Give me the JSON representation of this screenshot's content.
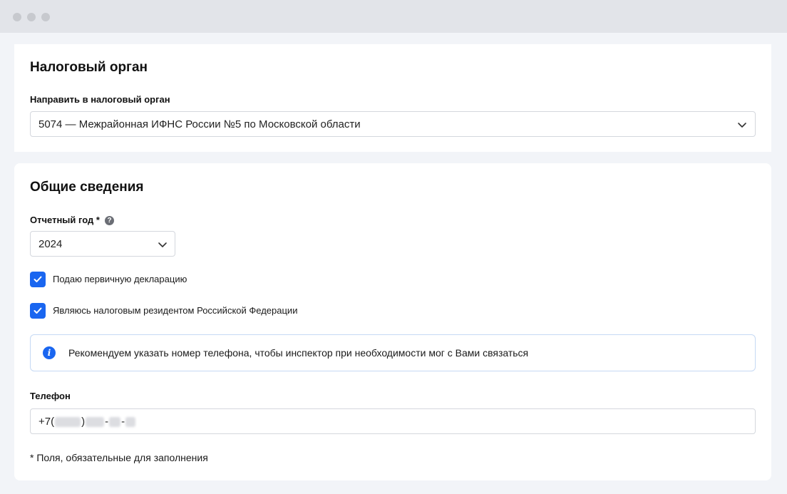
{
  "tax_authority": {
    "title": "Налоговый орган",
    "field_label": "Направить в налоговый орган",
    "selected": "5074 — Межрайонная ИФНС России №5 по Московской области"
  },
  "general": {
    "title": "Общие сведения",
    "year_label": "Отчетный год *",
    "year_value": "2024",
    "help_glyph": "?",
    "checkboxes": [
      {
        "label": "Подаю первичную декларацию",
        "checked": true
      },
      {
        "label": "Являюсь налоговым резидентом Российской Федерации",
        "checked": true
      }
    ],
    "info_glyph": "i",
    "info_text": "Рекомендуем указать номер телефона, чтобы инспектор при необходимости мог с Вами связаться",
    "phone_label": "Телефон",
    "phone_parts": [
      "+7(",
      ")",
      "-",
      "-"
    ],
    "footnote": "* Поля, обязательные для заполнения"
  },
  "colors": {
    "accent": "#1a66f0",
    "background": "#f2f4f8",
    "titlebar": "#e2e4e9"
  },
  "icons": [
    "chevron-down-icon",
    "help-icon",
    "check-icon",
    "info-icon"
  ]
}
